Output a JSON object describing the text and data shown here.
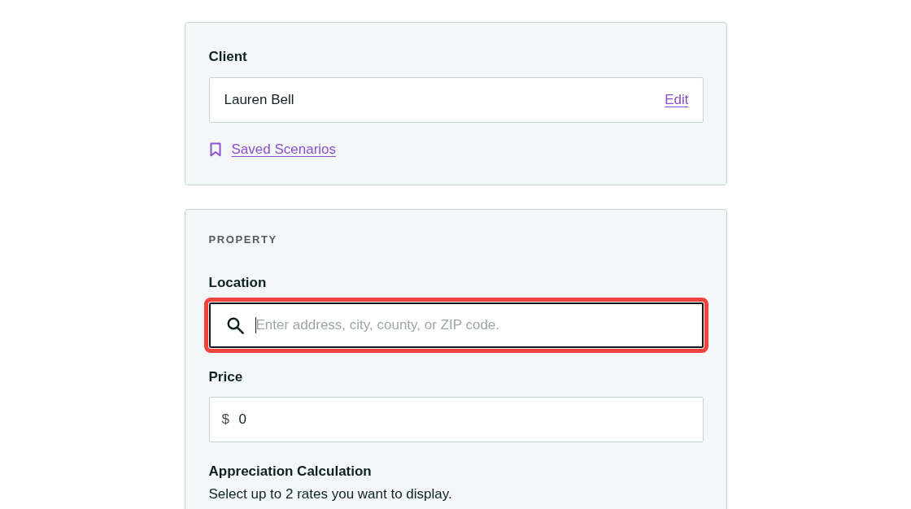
{
  "client_card": {
    "label": "Client",
    "client_name": "Lauren Bell",
    "edit_link": "Edit",
    "saved_link": "Saved Scenarios"
  },
  "property_card": {
    "heading": "PROPERTY",
    "fields": [
      {
        "kind": "search",
        "label": "Location",
        "placeholder": "Enter address, city, county, or ZIP code.",
        "focused": true,
        "highlighted": true
      },
      {
        "kind": "currency",
        "label": "Price",
        "prefix": "$",
        "value": "0",
        "focused": false,
        "highlighted": false
      }
    ],
    "appreciation": {
      "title": "Appreciation Calculation",
      "hint": "Select up to 2 rates you want to display."
    }
  }
}
